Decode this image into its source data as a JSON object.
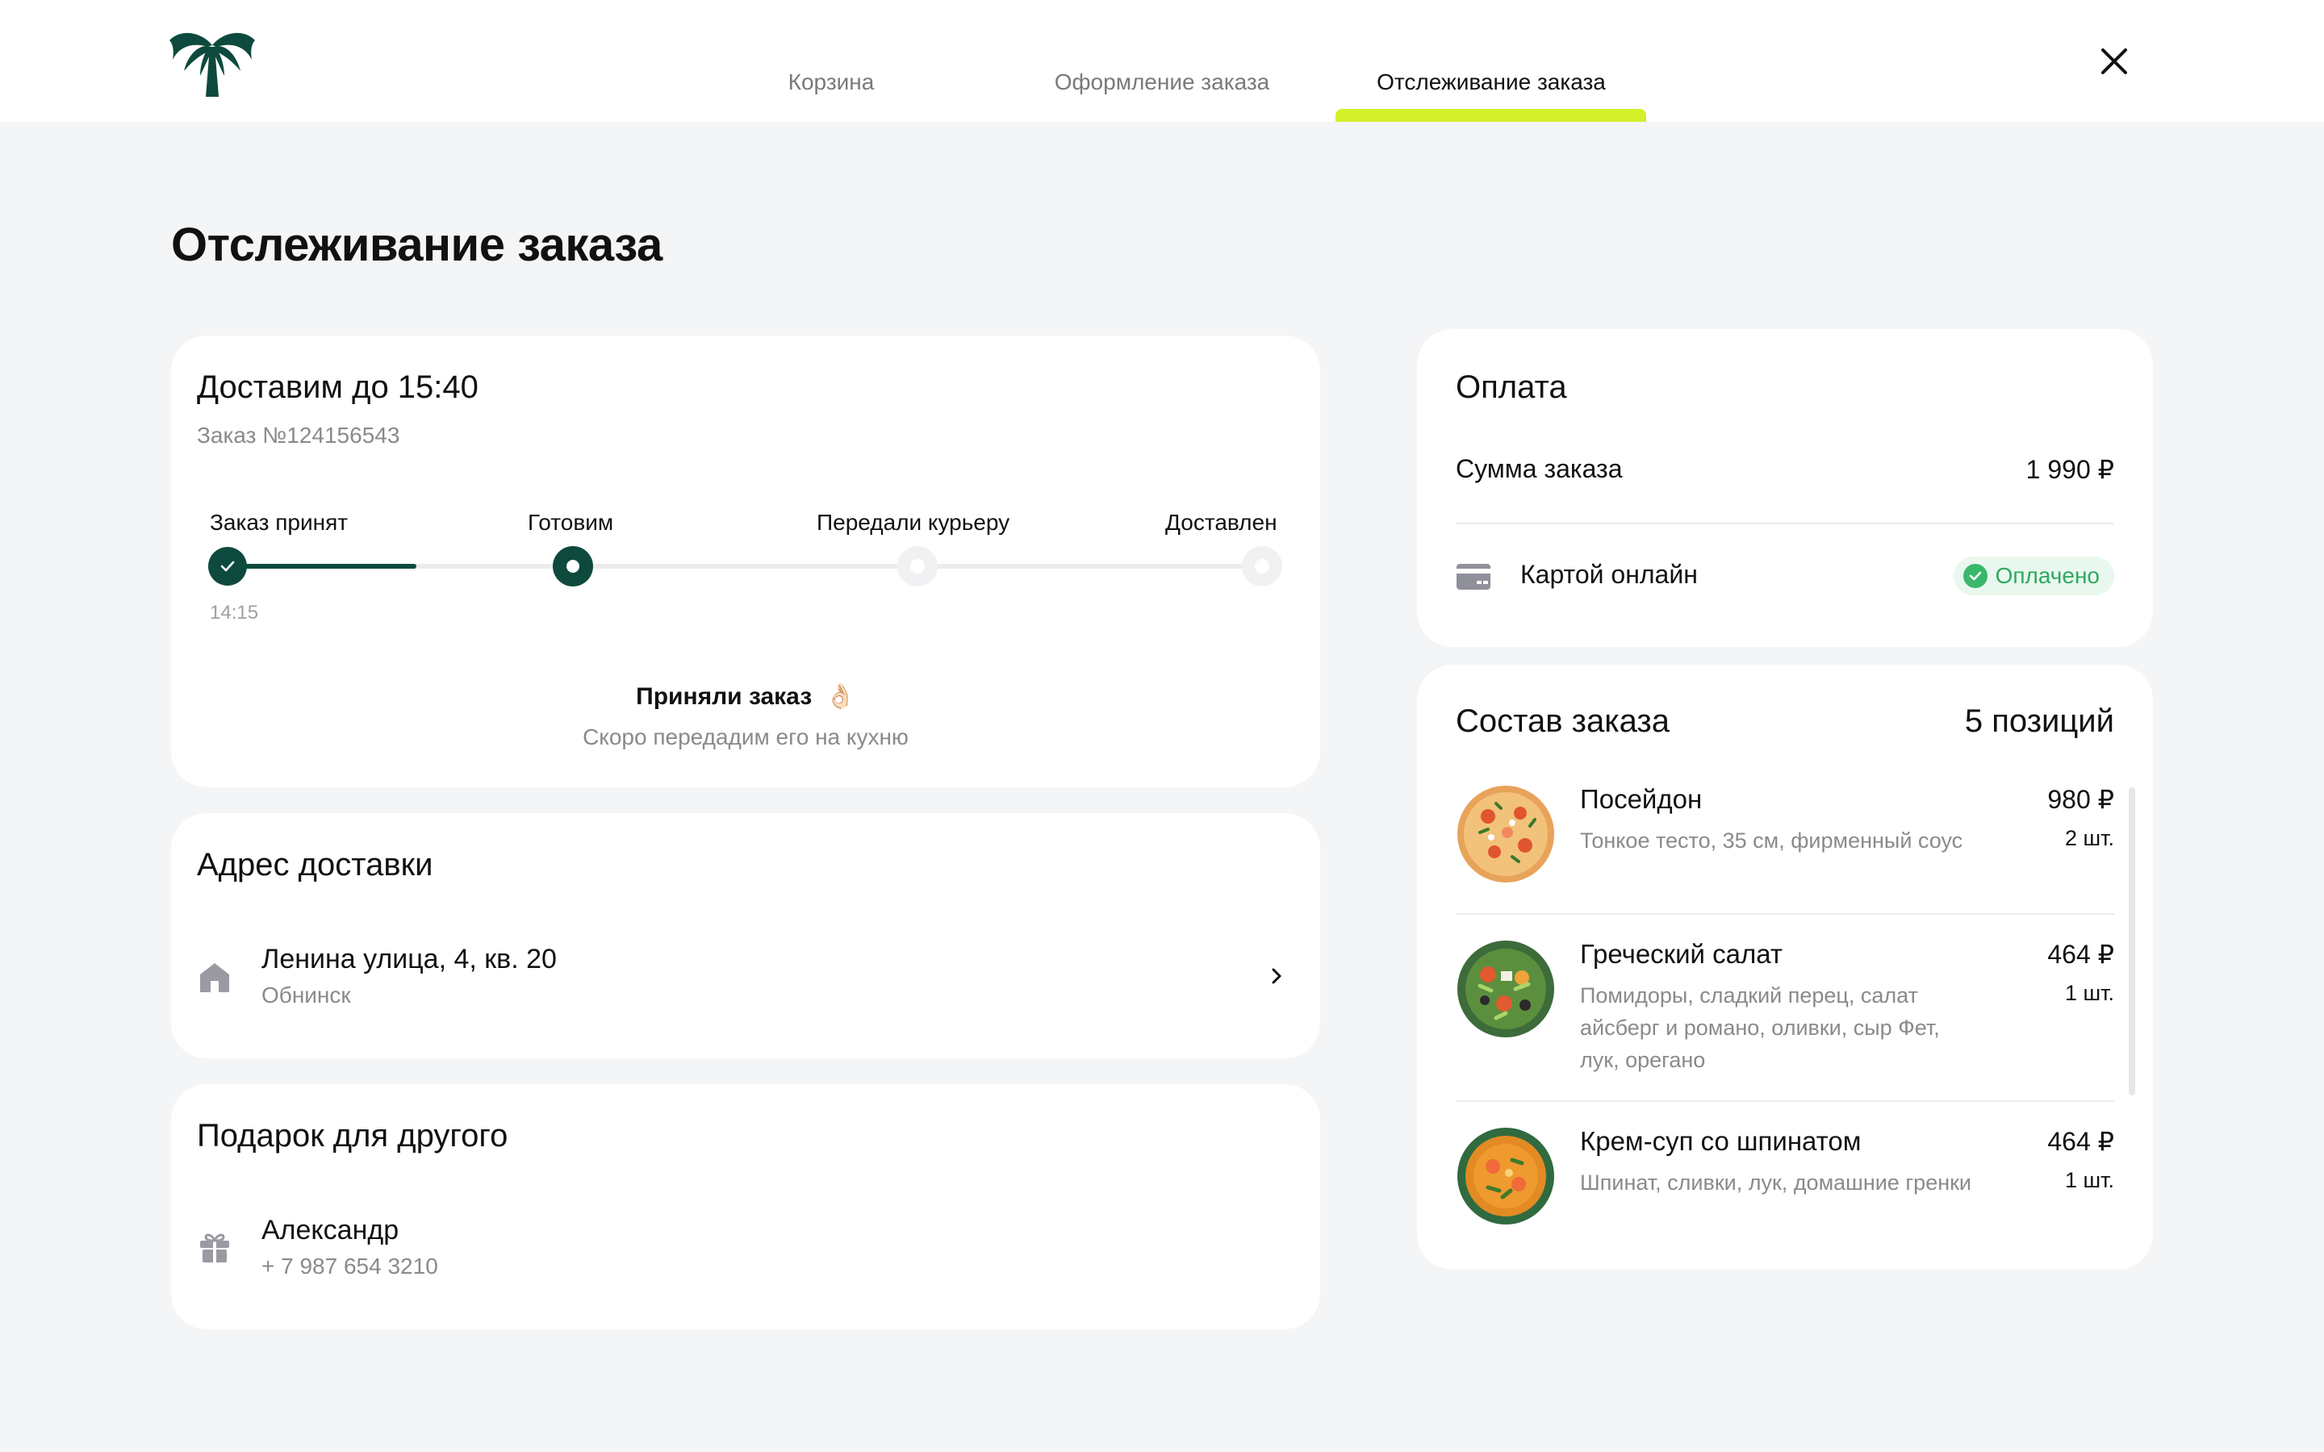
{
  "header": {
    "logo_icon": "palm-tree-icon",
    "tabs": [
      {
        "label": "Корзина"
      },
      {
        "label": "Оформление заказа"
      },
      {
        "label": "Отслеживание заказа"
      }
    ],
    "active_tab": 2,
    "accent_color": "#d4f02a",
    "close_icon": "close-icon"
  },
  "page": {
    "title": "Отслеживание заказа"
  },
  "delivery": {
    "title": "Доставим до 15:40",
    "order_number": "Заказ №124156543",
    "steps": [
      {
        "label": "Заказ принят",
        "state": "done",
        "time": "14:15"
      },
      {
        "label": "Готовим",
        "state": "current"
      },
      {
        "label": "Передали курьеру",
        "state": "pending"
      },
      {
        "label": "Доставлен",
        "state": "pending"
      }
    ],
    "progress_fraction": 0.18,
    "status_title": "Приняли заказ",
    "status_emoji": "👌🏻",
    "status_subtitle": "Скоро передадим его на кухню",
    "brand_color": "#0d4a3d"
  },
  "address": {
    "title": "Адрес доставки",
    "street": "Ленина улица, 4, кв. 20",
    "city": "Обнинск",
    "icon": "house-icon"
  },
  "gift": {
    "title": "Подарок для другого",
    "name": "Александр",
    "phone": "+ 7 987 654 3210",
    "icon": "gift-icon"
  },
  "payment": {
    "title": "Оплата",
    "sum_label": "Сумма заказа",
    "sum_value": "1 990 ₽",
    "method_label": "Картой онлайн",
    "method_icon": "credit-card-icon",
    "status": "Оплачено",
    "status_color": "#2ea860"
  },
  "order": {
    "title": "Состав заказа",
    "count": "5 позиций",
    "items": [
      {
        "name": "Посейдон",
        "desc": "Тонкое тесто, 35 см, фирменный соус",
        "price": "980 ₽",
        "qty": "2 шт.",
        "image": "pizza"
      },
      {
        "name": "Греческий салат",
        "desc": "Помидоры, сладкий перец, салат айсберг и романо, оливки, сыр Фет, лук, орегано",
        "price": "464 ₽",
        "qty": "1 шт.",
        "image": "salad"
      },
      {
        "name": "Крем-суп со шпинатом",
        "desc": "Шпинат, сливки, лук, домашние гренки",
        "price": "464 ₽",
        "qty": "1 шт.",
        "image": "soup"
      }
    ]
  }
}
